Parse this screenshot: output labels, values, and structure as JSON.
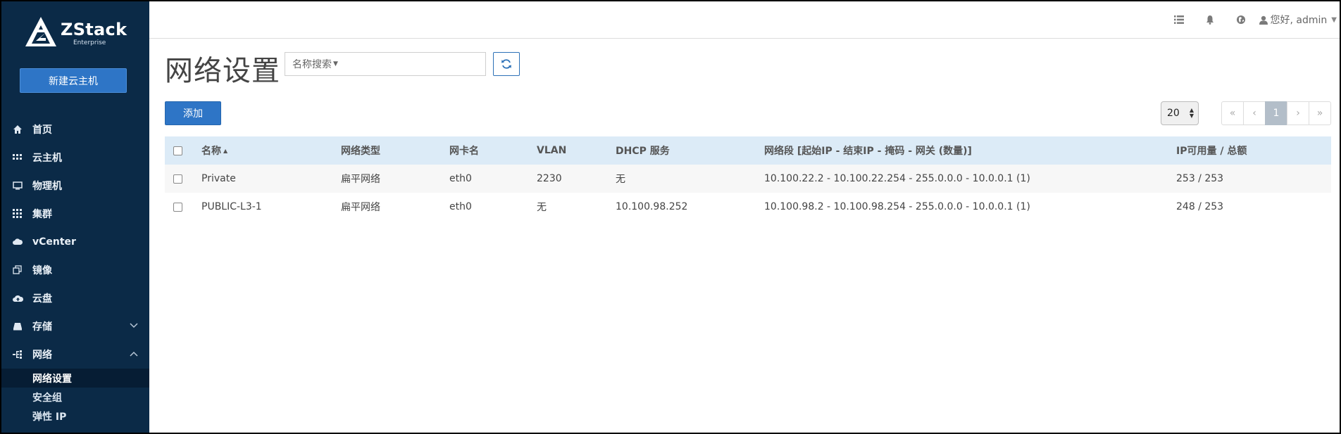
{
  "sidebar": {
    "logo": {
      "brand": "ZStack",
      "sub": "Enterprise"
    },
    "new_vm_label": "新建云主机",
    "items": [
      {
        "label": "首页",
        "icon": "home-icon"
      },
      {
        "label": "云主机",
        "icon": "vm-grid-icon"
      },
      {
        "label": "物理机",
        "icon": "monitor-icon"
      },
      {
        "label": "集群",
        "icon": "cluster-grid-icon"
      },
      {
        "label": "vCenter",
        "icon": "cloud-icon"
      },
      {
        "label": "镜像",
        "icon": "image-copy-icon"
      },
      {
        "label": "云盘",
        "icon": "cloud-upload-icon"
      },
      {
        "label": "存储",
        "icon": "storage-icon",
        "chevron": "chevron-down-icon"
      },
      {
        "label": "网络",
        "icon": "network-icon",
        "chevron": "chevron-up-icon"
      }
    ],
    "sub_items": [
      {
        "label": "网络设置",
        "active": true
      },
      {
        "label": "安全组"
      },
      {
        "label": "弹性 IP"
      }
    ]
  },
  "topbar": {
    "icons": [
      "list-icon",
      "bell-icon",
      "globe-icon"
    ],
    "user_label": "您好, admin"
  },
  "page": {
    "title": "网络设置",
    "search_placeholder": "名称搜索",
    "add_label": "添加",
    "page_size": "20",
    "pager": [
      "«",
      "‹",
      "1",
      "›",
      "»"
    ]
  },
  "table": {
    "columns": [
      "名称",
      "网络类型",
      "网卡名",
      "VLAN",
      "DHCP 服务",
      "网络段 [起始IP - 结束IP - 掩码 - 网关 (数量)]",
      "IP可用量 / 总额"
    ],
    "rows": [
      [
        "Private",
        "扁平网络",
        "eth0",
        "2230",
        "无",
        "10.100.22.2 - 10.100.22.254 - 255.0.0.0 - 10.0.0.1 (1)",
        "253 / 253"
      ],
      [
        "PUBLIC-L3-1",
        "扁平网络",
        "eth0",
        "无",
        "10.100.98.252",
        "10.100.98.2 - 10.100.98.254 - 255.0.0.0 - 10.0.0.1 (1)",
        "248 / 253"
      ]
    ]
  }
}
